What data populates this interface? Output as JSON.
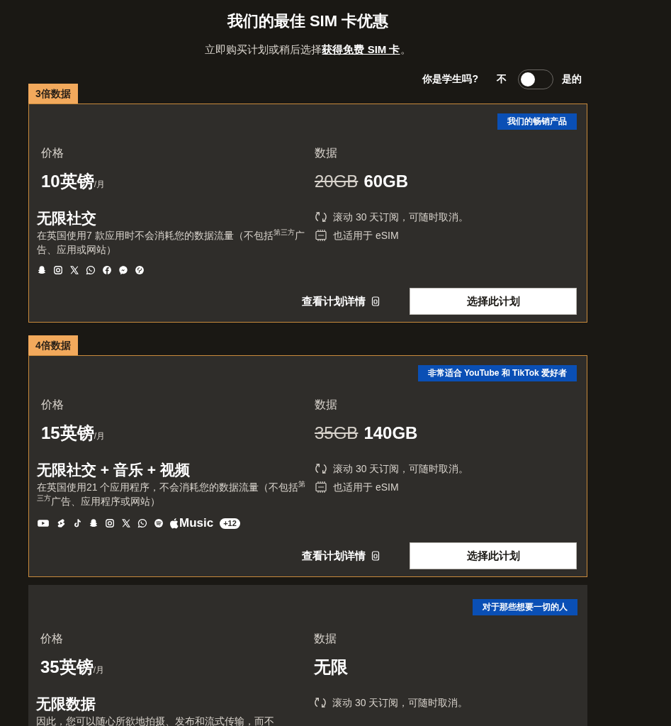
{
  "header": {
    "title": "我们的最佳 SIM 卡优惠",
    "subtitle": "立即购买计划或稍后选择",
    "subtitle_link": "获得免费 SIM 卡",
    "subtitle_end": "。"
  },
  "student_toggle": {
    "question": "你是学生吗?",
    "off_label": "不",
    "on_label": "是的",
    "on": false
  },
  "plans": [
    {
      "tag": "3倍数据",
      "badge": "我们的畅销产品",
      "price_label": "价格",
      "price": "10英镑",
      "per": "/月",
      "data_label": "数据",
      "old_data": "20GB",
      "data": "60GB",
      "feature_title": "无限社交",
      "description": "在英国使用7 款应用时不会消耗您的数据流量（不包括$^{第三方}$广告、应用或网站）",
      "apps": [
        {
          "kind": "ghost"
        },
        {
          "kind": "camera"
        },
        {
          "kind": "x"
        },
        {
          "kind": "phone-bubble"
        },
        {
          "kind": "f-circle"
        },
        {
          "kind": "lightning-bubble"
        },
        {
          "kind": "pin-circle"
        }
      ],
      "features": [
        {
          "kind": "renew",
          "text": "滚动 30 天订阅，可随时取消。"
        },
        {
          "kind": "esim",
          "text": "也适用于 eSIM"
        }
      ],
      "details_link": "查看计划详情",
      "button": "选择此计划"
    },
    {
      "tag": "4倍数据",
      "badge": "非常适合 YouTube 和 TikTok 爱好者",
      "price_label": "价格",
      "price": "15英镑",
      "per": "/月",
      "data_label": "数据",
      "old_data": "35GB",
      "data": "140GB",
      "feature_title": "无限社交 + 音乐 + 视频",
      "description": "在英国使用21 个应用程序，不会消耗您的数据流量（不包括$^{第三方}$广告、应用程序或网站）",
      "apps": [
        {
          "kind": "play"
        },
        {
          "kind": "bolt"
        },
        {
          "kind": "note"
        },
        {
          "kind": "ghost"
        },
        {
          "kind": "camera"
        },
        {
          "kind": "x"
        },
        {
          "kind": "phone-bubble"
        },
        {
          "kind": "waves-circle"
        },
        {
          "kind": "apple-music",
          "label": "Music"
        },
        {
          "kind": "more",
          "label": "+12"
        }
      ],
      "features": [
        {
          "kind": "renew",
          "text": "滚动 30 天订阅，可随时取消。"
        },
        {
          "kind": "esim",
          "text": "也适用于 eSIM"
        }
      ],
      "details_link": "查看计划详情",
      "button": "选择此计划"
    },
    {
      "badge": "对于那些想要一切的人",
      "price_label": "价格",
      "price": "35英镑",
      "per": "/月",
      "data_label": "数据",
      "data": "无限",
      "feature_title": "无限数据",
      "description": "因此，您可以随心所欲地拍摄、发布和流式传输，而不",
      "features": [
        {
          "kind": "renew",
          "text": "滚动 30 天订阅，可随时取消。"
        }
      ]
    }
  ]
}
